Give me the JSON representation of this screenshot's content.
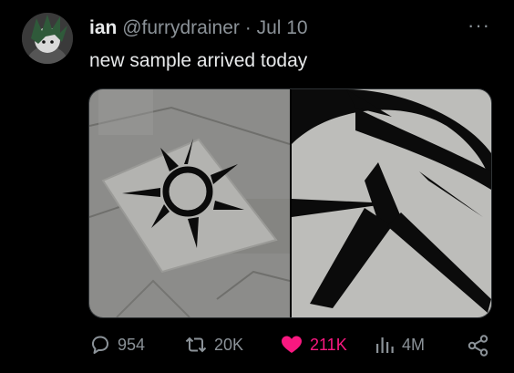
{
  "tweet": {
    "display_name": "ian",
    "handle": "@furrydrainer",
    "separator": "·",
    "date": "Jul 10",
    "more_label": "···",
    "text": "new sample arrived today"
  },
  "media": {
    "images": [
      {
        "icon": "rug-photo-full"
      },
      {
        "icon": "rug-photo-closeup"
      }
    ]
  },
  "actions": {
    "reply_count": "954",
    "retweet_count": "20K",
    "like_count": "211K",
    "view_count": "4M",
    "liked": true
  },
  "colors": {
    "background": "#000000",
    "text": "#e7e9ea",
    "muted": "#8b9298",
    "like": "#f91880"
  }
}
